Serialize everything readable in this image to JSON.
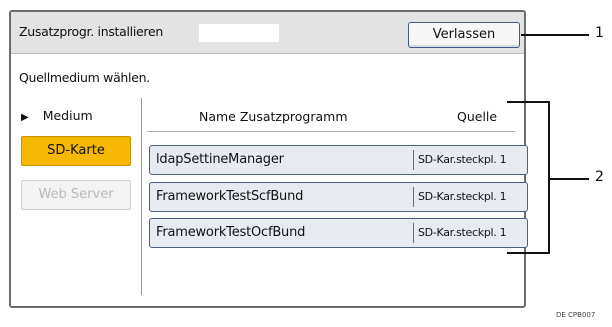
{
  "title_bar": {
    "title": "Zusatzprogr. installieren",
    "exit_label": "Verlassen"
  },
  "instruction": "Quellmedium wählen.",
  "medium_panel": {
    "label": "Medium",
    "buttons": [
      {
        "label": "SD-Karte",
        "state": "selected"
      },
      {
        "label": "Web Server",
        "state": "disabled"
      }
    ]
  },
  "program_list": {
    "columns": [
      "Name Zusatzprogramm",
      "Quelle"
    ],
    "rows": [
      {
        "name": "ldapSettineManager",
        "source": "SD-Kar.steckpl. 1"
      },
      {
        "name": "FrameworkTestScfBund",
        "source": "SD-Kar.steckpl. 1"
      },
      {
        "name": "FrameworkTestOcfBund",
        "source": "SD-Kar.steckpl. 1"
      }
    ]
  },
  "callouts": [
    "1",
    "2"
  ],
  "figure_code": "DE CPB007",
  "colors": {
    "selected_medium": "#f6b800",
    "button_border": "#3f5a86",
    "title_bar_bg": "#e3e3e3"
  }
}
